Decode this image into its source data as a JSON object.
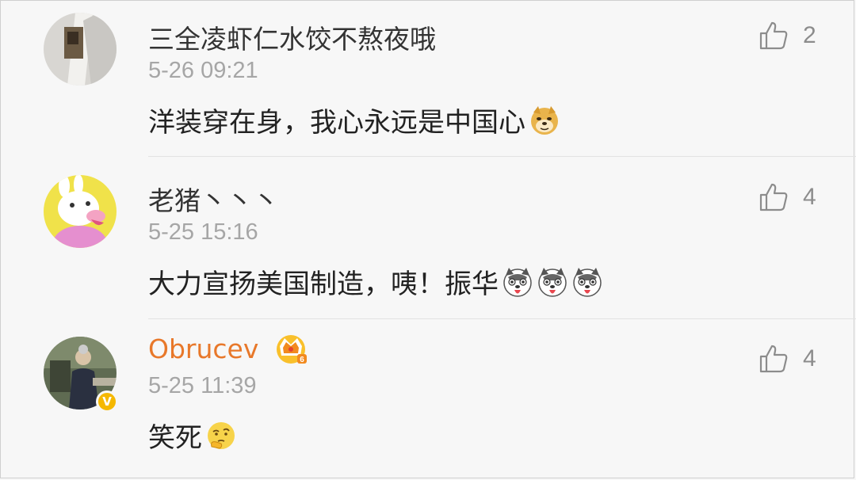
{
  "comments": [
    {
      "username": "三全凌虾仁水饺不熬夜哦",
      "time": "5-26 09:21",
      "text": "洋装穿在身，我心永远是中国心",
      "emojis": [
        "doge-emoji"
      ],
      "likes": "2",
      "verified": false,
      "vip": false
    },
    {
      "username": "老猪丶丶丶",
      "time": "5-25 15:16",
      "text": "大力宣扬美国制造，咦！振华",
      "emojis": [
        "husky-emoji",
        "husky-emoji",
        "husky-emoji"
      ],
      "likes": "4",
      "verified": false,
      "vip": false
    },
    {
      "username": "Obrucev",
      "time": "5-25 11:39",
      "text": "笑死",
      "emojis": [
        "thinking-emoji"
      ],
      "likes": "4",
      "verified": true,
      "vip": true
    }
  ],
  "colors": {
    "vip_name": "#e8782a",
    "verified_badge": "#f5b800",
    "timestamp": "#a6a6a6",
    "like": "#8c8c8c"
  },
  "icons": [
    "thumbs-up-icon",
    "crown-icon",
    "verified-badge-icon"
  ]
}
